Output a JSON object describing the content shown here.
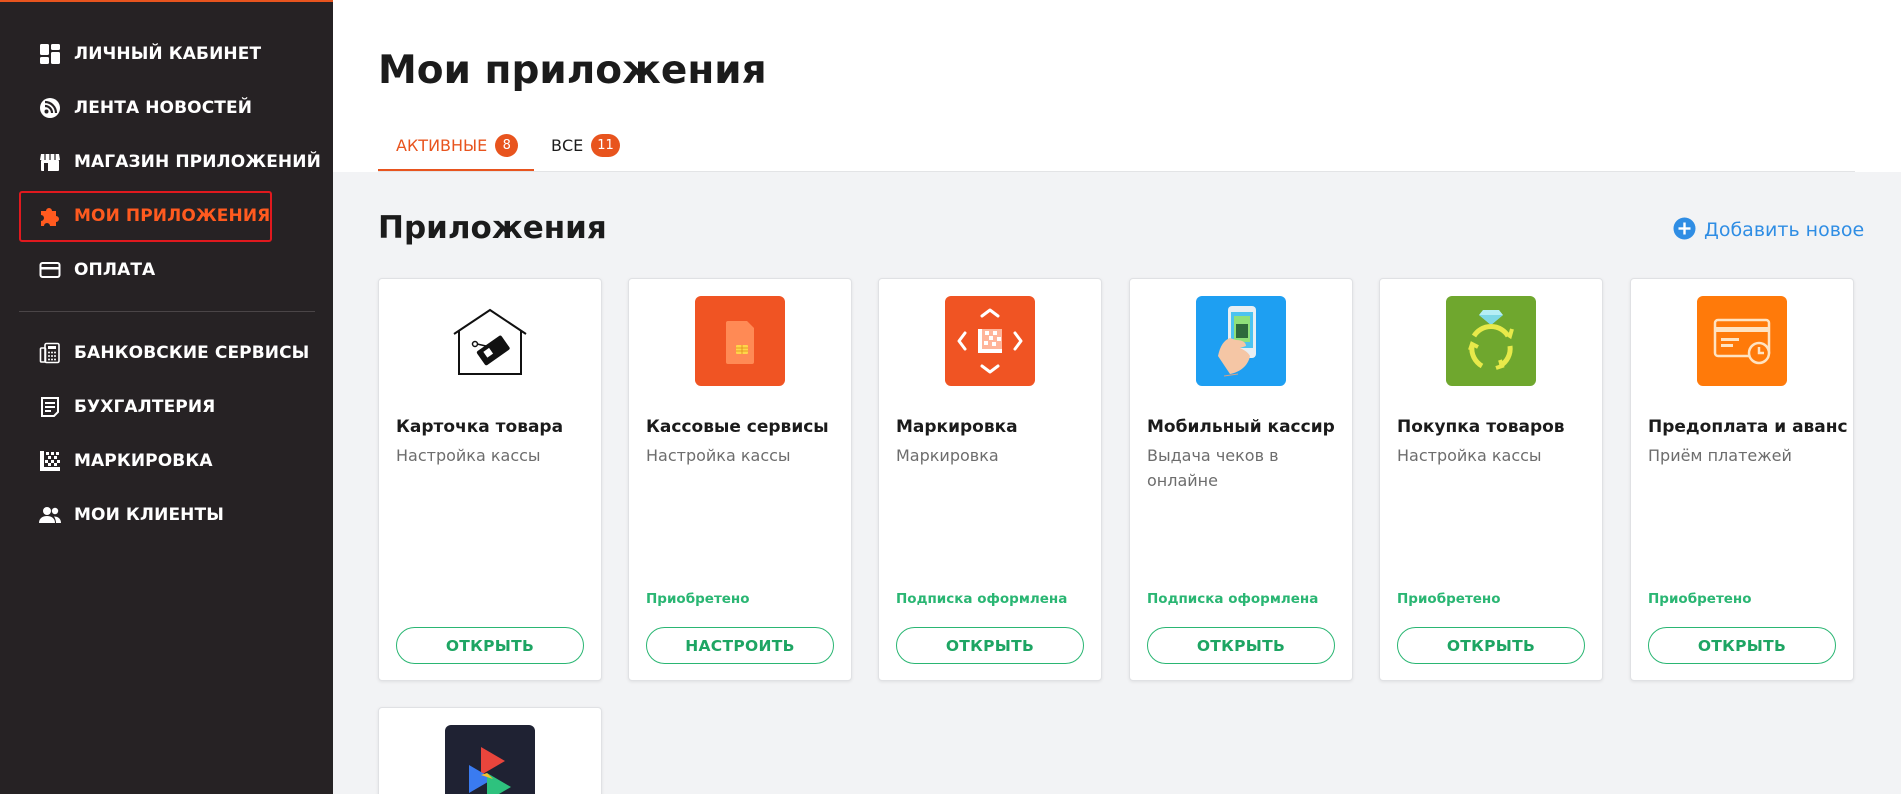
{
  "sidebar": {
    "items": [
      {
        "label": "ЛИЧНЫЙ КАБИНЕТ",
        "icon": "dashboard-icon"
      },
      {
        "label": "ЛЕНТА НОВОСТЕЙ",
        "icon": "rss-icon"
      },
      {
        "label": "МАГАЗИН ПРИЛОЖЕНИЙ",
        "icon": "store-icon"
      },
      {
        "label": "МОИ ПРИЛОЖЕНИЯ",
        "icon": "puzzle-icon",
        "active": true
      },
      {
        "label": "ОПЛАТА",
        "icon": "credit-card-icon"
      },
      {
        "label": "БАНКОВСКИЕ СЕРВИСЫ",
        "icon": "bank-calculator-icon"
      },
      {
        "label": "БУХГАЛТЕРИЯ",
        "icon": "accounting-document-icon"
      },
      {
        "label": "МАРКИРОВКА",
        "icon": "datamatrix-icon"
      },
      {
        "label": "МОИ КЛИЕНТЫ",
        "icon": "people-icon"
      }
    ]
  },
  "header": {
    "title": "Мои приложения",
    "tabs": [
      {
        "label": "АКТИВНЫЕ",
        "count": "8",
        "active": true
      },
      {
        "label": "ВСЕ",
        "count": "11"
      }
    ]
  },
  "section": {
    "title": "Приложения",
    "add_new_label": "Добавить новое"
  },
  "cards": [
    {
      "name": "Карточка товара",
      "desc": "Настройка кассы",
      "status": "",
      "button": "ОТКРЫТЬ",
      "icon": "product-card-house-icon"
    },
    {
      "name": "Кассовые сервисы",
      "desc": "Настройка кассы",
      "status": "Приобретено",
      "button": "НАСТРОИТЬ",
      "icon": "sim-card-icon"
    },
    {
      "name": "Маркировка",
      "desc": "Маркировка",
      "status": "Подписка оформлена",
      "button": "ОТКРЫТЬ",
      "icon": "scan-datamatrix-icon"
    },
    {
      "name": "Мобильный кассир",
      "desc": "Выдача чеков в онлайне",
      "status": "Подписка оформлена",
      "button": "ОТКРЫТЬ",
      "icon": "mobile-phone-hand-icon"
    },
    {
      "name": "Покупка товаров",
      "desc": "Настройка кассы",
      "status": "Приобретено",
      "button": "ОТКРЫТЬ",
      "icon": "diamond-ring-cycle-icon"
    },
    {
      "name": "Предоплата и аванс",
      "desc": "Приём платежей",
      "status": "Приобретено",
      "button": "ОТКРЫТЬ",
      "icon": "card-clock-icon"
    }
  ],
  "colors": {
    "sidebar_bg": "#262224",
    "accent": "#e8541e",
    "active_highlight_border": "#e0191e",
    "status_green": "#2ab673",
    "link_blue": "#2f8de4"
  }
}
